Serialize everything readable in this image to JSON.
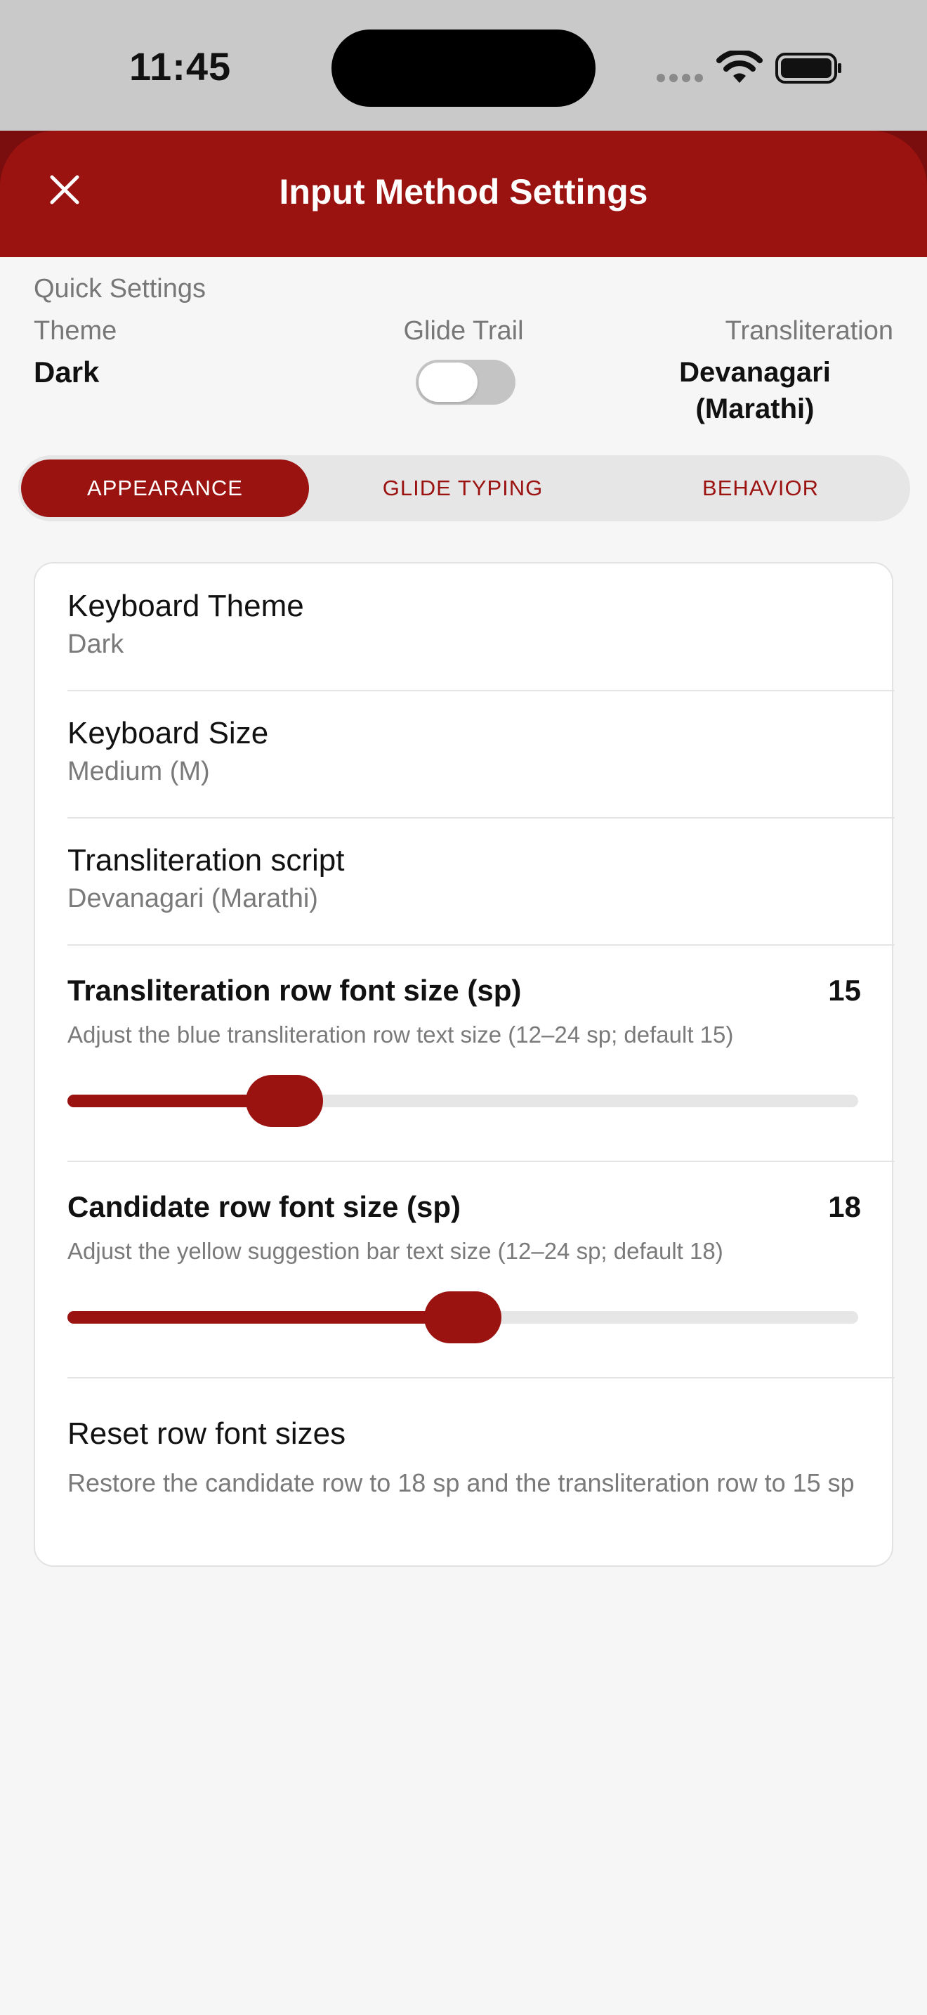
{
  "status_bar": {
    "time": "11:45"
  },
  "header": {
    "title": "Input Method Settings"
  },
  "quick_settings": {
    "label": "Quick Settings",
    "theme_label": "Theme",
    "theme_value": "Dark",
    "glide_label": "Glide Trail",
    "glide_enabled": false,
    "transliteration_label": "Transliteration",
    "transliteration_value_line1": "Devanagari",
    "transliteration_value_line2": "(Marathi)"
  },
  "tabs": [
    {
      "label": "APPEARANCE",
      "active": true
    },
    {
      "label": "GLIDE TYPING",
      "active": false
    },
    {
      "label": "BEHAVIOR",
      "active": false
    }
  ],
  "settings": {
    "keyboard_theme": {
      "title": "Keyboard Theme",
      "value": "Dark"
    },
    "keyboard_size": {
      "title": "Keyboard Size",
      "value": "Medium (M)"
    },
    "transliteration_script": {
      "title": "Transliteration script",
      "value": "Devanagari (Marathi)"
    },
    "transliteration_font": {
      "title": "Transliteration row font size (sp)",
      "value": "15",
      "description": "Adjust the blue transliteration row text size (12–24 sp; default 15)",
      "min": 12,
      "max": 24,
      "current": 15
    },
    "candidate_font": {
      "title": "Candidate row font size (sp)",
      "value": "18",
      "description": "Adjust the yellow suggestion bar text size (12–24 sp; default 18)",
      "min": 12,
      "max": 24,
      "current": 18
    },
    "reset": {
      "title": "Reset row font sizes",
      "description": "Restore the candidate row to 18 sp and the transliteration row to 15 sp"
    }
  },
  "colors": {
    "accent": "#9b1311",
    "background": "#f6f6f6"
  }
}
